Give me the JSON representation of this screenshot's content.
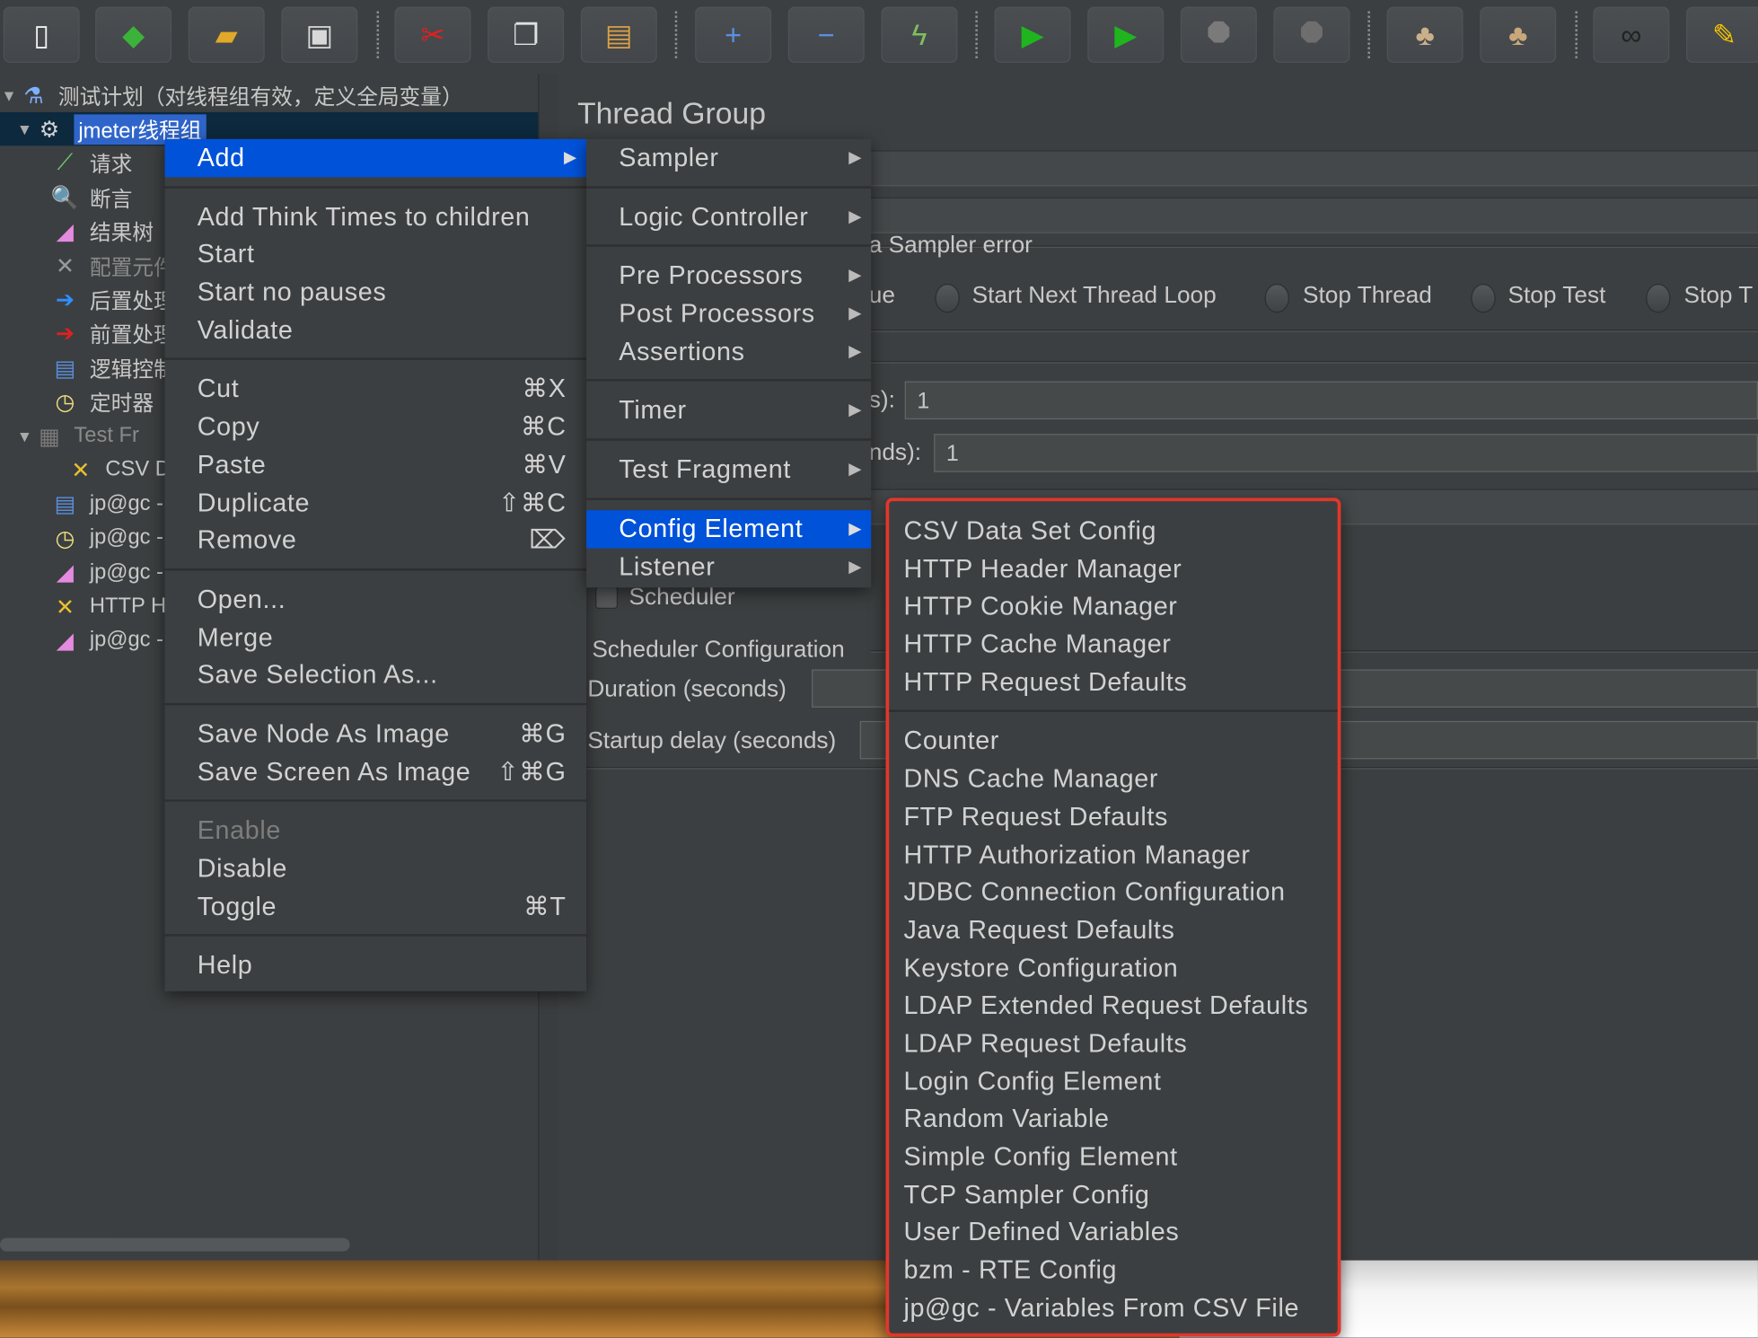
{
  "toolbar": {
    "buttons": [
      {
        "icon": "new-file-icon",
        "glyph": "▯",
        "color": "#f0f0f0"
      },
      {
        "icon": "templates-icon",
        "glyph": "◆",
        "color": "#3bb33b"
      },
      {
        "icon": "open-folder-icon",
        "glyph": "▰",
        "color": "#e0a92a"
      },
      {
        "icon": "save-icon",
        "glyph": "▣",
        "color": "#d8d8d8"
      },
      {
        "icon": "cut-icon",
        "glyph": "✂",
        "color": "#e02020"
      },
      {
        "icon": "copy-icon",
        "glyph": "❐",
        "color": "#e0e0e0"
      },
      {
        "icon": "paste-icon",
        "glyph": "▤",
        "color": "#d9a047"
      },
      {
        "icon": "expand-icon",
        "glyph": "+",
        "color": "#5a8fe0"
      },
      {
        "icon": "collapse-icon",
        "glyph": "−",
        "color": "#5a8fe0"
      },
      {
        "icon": "toggle-icon",
        "glyph": "ϟ",
        "color": "#7fbf5f"
      },
      {
        "icon": "start-icon",
        "glyph": "▶",
        "color": "#1fb51f"
      },
      {
        "icon": "start-no-pauses-icon",
        "glyph": "▶",
        "color": "#1fb51f"
      },
      {
        "icon": "stop-icon",
        "glyph": "⯃",
        "color": "#7a7a7a"
      },
      {
        "icon": "shutdown-icon",
        "glyph": "⯃",
        "color": "#6e6e6e"
      },
      {
        "icon": "clear-icon",
        "glyph": "♣",
        "color": "#c9b08a"
      },
      {
        "icon": "clear-all-icon",
        "glyph": "♣",
        "color": "#c9a77a"
      },
      {
        "icon": "search-binoculars-icon",
        "glyph": "∞",
        "color": "#222222"
      },
      {
        "icon": "reset-search-broom-icon",
        "glyph": "✎",
        "color": "#f2c200"
      }
    ]
  },
  "tree": {
    "items": [
      {
        "label": "测试计划（对线程组有效，定义全局变量）",
        "icon": "test-plan-flask-icon",
        "glyph": "⚗",
        "color": "#7fb0ff",
        "arrow": "▼",
        "indent": 0
      },
      {
        "label": "jmeter线程组",
        "icon": "thread-group-gear-icon",
        "glyph": "⚙",
        "color": "#d0d0d0",
        "arrow": "▼",
        "indent": 1,
        "selected": true
      },
      {
        "label": "请求",
        "icon": "sampler-pipette-icon",
        "glyph": "⟋",
        "color": "#6fcf6f",
        "indent": 2
      },
      {
        "label": "断言",
        "icon": "assertion-magnifier-icon",
        "glyph": "🔍",
        "color": "#8ecbff",
        "indent": 2
      },
      {
        "label": "结果树",
        "icon": "listener-graph-icon",
        "glyph": "◢",
        "color": "#e48adf",
        "indent": 2
      },
      {
        "label": "配置元件",
        "icon": "config-tools-icon",
        "glyph": "✕",
        "color": "#9a9a9a",
        "indent": 2,
        "dim": true
      },
      {
        "label": "后置处理器",
        "icon": "post-processor-icon",
        "glyph": "➔",
        "color": "#2f8fff",
        "indent": 2
      },
      {
        "label": "前置处理器",
        "icon": "pre-processor-icon",
        "glyph": "➔",
        "color": "#e02020",
        "indent": 2
      },
      {
        "label": "逻辑控制器",
        "icon": "logic-controller-icon",
        "glyph": "▤",
        "color": "#5a8fe0",
        "indent": 2
      },
      {
        "label": "定时器",
        "icon": "timer-stopwatch-icon",
        "glyph": "◷",
        "color": "#f0e080",
        "indent": 2
      },
      {
        "label": "Test Fr",
        "icon": "test-fragment-icon",
        "glyph": "▦",
        "color": "#7a7a7a",
        "arrow": "▼",
        "indent": 1,
        "dim": true
      },
      {
        "label": "CSV D",
        "icon": "config-tools-icon",
        "glyph": "✕",
        "color": "#e8c030",
        "indent": 3
      },
      {
        "label": "jp@gc -",
        "icon": "logic-controller-icon",
        "glyph": "▤",
        "color": "#5a8fe0",
        "indent": 2
      },
      {
        "label": "jp@gc -",
        "icon": "timer-stopwatch-icon",
        "glyph": "◷",
        "color": "#f0e080",
        "indent": 2
      },
      {
        "label": "jp@gc -",
        "icon": "listener-graph-icon",
        "glyph": "◢",
        "color": "#e48adf",
        "indent": 2
      },
      {
        "label": "HTTP H",
        "icon": "config-tools-icon",
        "glyph": "✕",
        "color": "#e8c030",
        "indent": 2
      },
      {
        "label": "jp@gc -",
        "icon": "listener-graph-icon",
        "glyph": "◢",
        "color": "#e48adf",
        "indent": 2
      }
    ]
  },
  "panel": {
    "title": "Thread Group",
    "error_group_label": "a Sampler error",
    "continue_fragment": "ue",
    "radio_start_next": "Start Next Thread Loop",
    "radio_stop_thread": "Stop Thread",
    "radio_stop_test": "Stop Test",
    "radio_stop_test_now_fragment": "Stop T",
    "threads_label_fragment": "s):",
    "threads_value": "1",
    "rampup_label_fragment": "nds):",
    "rampup_value": "1",
    "scheduler_label": "Scheduler",
    "scheduler_config_label": "Scheduler Configuration",
    "duration_label": "Duration (seconds)",
    "startup_delay_label": "Startup delay (seconds)"
  },
  "context_menu": {
    "items": [
      {
        "label": "Add",
        "submenu": true,
        "highlighted": true
      },
      {
        "label": "Add Think Times to children",
        "sep": true
      },
      {
        "label": "Start"
      },
      {
        "label": "Start no pauses"
      },
      {
        "label": "Validate"
      },
      {
        "label": "Cut",
        "shortcut": "⌘X",
        "sep": true
      },
      {
        "label": "Copy",
        "shortcut": "⌘C"
      },
      {
        "label": "Paste",
        "shortcut": "⌘V"
      },
      {
        "label": "Duplicate",
        "shortcut": "⇧⌘C"
      },
      {
        "label": "Remove",
        "shortcut": "⌦"
      },
      {
        "label": "Open...",
        "sep": true
      },
      {
        "label": "Merge"
      },
      {
        "label": "Save Selection As..."
      },
      {
        "label": "Save Node As Image",
        "shortcut": "⌘G",
        "sep": true
      },
      {
        "label": "Save Screen As Image",
        "shortcut": "⇧⌘G"
      },
      {
        "label": "Enable",
        "disabled": true,
        "sep": true
      },
      {
        "label": "Disable"
      },
      {
        "label": "Toggle",
        "shortcut": "⌘T"
      },
      {
        "label": "Help",
        "sep": true
      }
    ]
  },
  "add_submenu": {
    "items": [
      {
        "label": "Sampler",
        "submenu": true
      },
      {
        "label": "Logic Controller",
        "submenu": true,
        "sep": true
      },
      {
        "label": "Pre Processors",
        "submenu": true,
        "sep": true
      },
      {
        "label": "Post Processors",
        "submenu": true
      },
      {
        "label": "Assertions",
        "submenu": true
      },
      {
        "label": "Timer",
        "submenu": true,
        "sep": true
      },
      {
        "label": "Test Fragment",
        "submenu": true,
        "sep": true
      },
      {
        "label": "Config Element",
        "submenu": true,
        "highlighted": true,
        "sep": true
      },
      {
        "label": "Listener",
        "submenu": true
      }
    ]
  },
  "config_submenu": {
    "highlight_color": "#e0372b",
    "items": [
      {
        "label": "CSV Data Set Config"
      },
      {
        "label": "HTTP Header Manager"
      },
      {
        "label": "HTTP Cookie Manager"
      },
      {
        "label": "HTTP Cache Manager"
      },
      {
        "label": "HTTP Request Defaults"
      },
      {
        "label": "Counter",
        "sep": true
      },
      {
        "label": "DNS Cache Manager"
      },
      {
        "label": "FTP Request Defaults"
      },
      {
        "label": "HTTP Authorization Manager"
      },
      {
        "label": "JDBC Connection Configuration"
      },
      {
        "label": "Java Request Defaults"
      },
      {
        "label": "Keystore Configuration"
      },
      {
        "label": "LDAP Extended Request Defaults"
      },
      {
        "label": "LDAP Request Defaults"
      },
      {
        "label": "Login Config Element"
      },
      {
        "label": "Random Variable"
      },
      {
        "label": "Simple Config Element"
      },
      {
        "label": "TCP Sampler Config"
      },
      {
        "label": "User Defined Variables"
      },
      {
        "label": "bzm - RTE Config"
      },
      {
        "label": "jp@gc - Variables From CSV File"
      }
    ]
  },
  "colors": {
    "selection": "#0052d9",
    "tree_selection": "#2f65ca",
    "background": "#3c3f41"
  }
}
